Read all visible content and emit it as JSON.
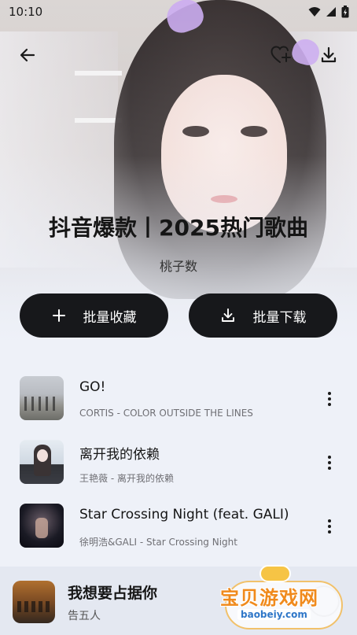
{
  "status_bar": {
    "time": "10:10"
  },
  "header": {
    "back_icon": "back-arrow-icon",
    "favorite_icon": "heart-plus-icon",
    "download_icon": "download-icon"
  },
  "playlist": {
    "title": "抖音爆款丨2025热门歌曲",
    "creator": "桃子数"
  },
  "actions": {
    "collect_label": "批量收藏",
    "download_label": "批量下载"
  },
  "songs": [
    {
      "title": "GO!",
      "subtitle": "CORTIS - COLOR OUTSIDE THE LINES"
    },
    {
      "title": "离开我的依赖",
      "subtitle": "王艳薇 - 离开我的依赖"
    },
    {
      "title": "Star Crossing Night (feat. GALI)",
      "subtitle": "徐明浩&GALI - Star Crossing Night"
    }
  ],
  "now_playing": {
    "title": "我想要占据你",
    "artist": "告五人"
  },
  "watermark": {
    "text": "宝贝游戏网",
    "url": "baobeiy.com"
  },
  "colors": {
    "background": "#eef1f8",
    "button_bg": "#17181b",
    "player_bg": "#e4e8f1",
    "watermark_orange": "#f08a1c"
  }
}
